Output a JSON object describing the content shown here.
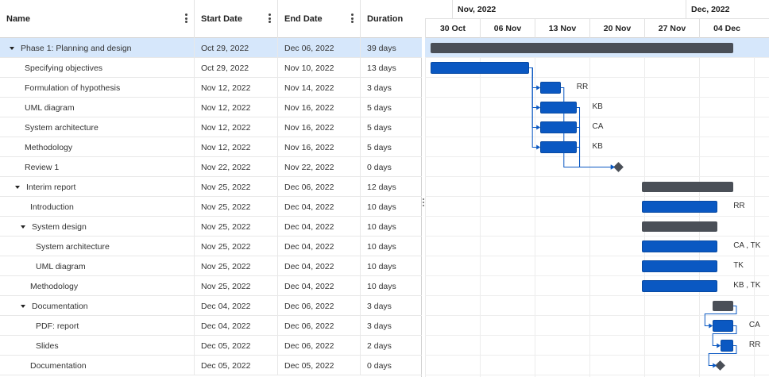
{
  "columns": {
    "name": "Name",
    "start": "Start Date",
    "end": "End Date",
    "duration": "Duration"
  },
  "timeline": {
    "months": [
      {
        "label": "Nov, 2022"
      },
      {
        "label": "Dec, 2022"
      }
    ],
    "weeks": [
      "30 Oct",
      "06 Nov",
      "13 Nov",
      "20 Nov",
      "27 Nov",
      "04 Dec"
    ]
  },
  "tasks": [
    {
      "name": "Phase 1: Planning and design",
      "start": "Oct 29, 2022",
      "end": "Dec 06, 2022",
      "duration": "39 days",
      "level": 0,
      "parent": true,
      "selected": true
    },
    {
      "name": "Specifying objectives",
      "start": "Oct 29, 2022",
      "end": "Nov 10, 2022",
      "duration": "13 days",
      "level": 1,
      "resource": ""
    },
    {
      "name": "Formulation of hypothesis",
      "start": "Nov 12, 2022",
      "end": "Nov 14, 2022",
      "duration": "3 days",
      "level": 1,
      "resource": "RR"
    },
    {
      "name": "UML diagram",
      "start": "Nov 12, 2022",
      "end": "Nov 16, 2022",
      "duration": "5 days",
      "level": 1,
      "resource": "KB"
    },
    {
      "name": "System architecture",
      "start": "Nov 12, 2022",
      "end": "Nov 16, 2022",
      "duration": "5 days",
      "level": 1,
      "resource": "CA"
    },
    {
      "name": "Methodology",
      "start": "Nov 12, 2022",
      "end": "Nov 16, 2022",
      "duration": "5 days",
      "level": 1,
      "resource": "KB"
    },
    {
      "name": "Review 1",
      "start": "Nov 22, 2022",
      "end": "Nov 22, 2022",
      "duration": "0 days",
      "level": 1,
      "milestone": true
    },
    {
      "name": "Interim report",
      "start": "Nov 25, 2022",
      "end": "Dec 06, 2022",
      "duration": "12 days",
      "level": 1,
      "parent": true
    },
    {
      "name": "Introduction",
      "start": "Nov 25, 2022",
      "end": "Dec 04, 2022",
      "duration": "10 days",
      "level": 2,
      "resource": "RR"
    },
    {
      "name": "System design",
      "start": "Nov 25, 2022",
      "end": "Dec 04, 2022",
      "duration": "10 days",
      "level": 2,
      "parent": true
    },
    {
      "name": "System architecture",
      "start": "Nov 25, 2022",
      "end": "Dec 04, 2022",
      "duration": "10 days",
      "level": 3,
      "resource": "CA , TK"
    },
    {
      "name": "UML diagram",
      "start": "Nov 25, 2022",
      "end": "Dec 04, 2022",
      "duration": "10 days",
      "level": 3,
      "resource": "TK"
    },
    {
      "name": "Methodology",
      "start": "Nov 25, 2022",
      "end": "Dec 04, 2022",
      "duration": "10 days",
      "level": 2,
      "resource": "KB , TK"
    },
    {
      "name": "Documentation",
      "start": "Dec 04, 2022",
      "end": "Dec 06, 2022",
      "duration": "3 days",
      "level": 2,
      "parent": true
    },
    {
      "name": "PDF: report",
      "start": "Dec 04, 2022",
      "end": "Dec 06, 2022",
      "duration": "3 days",
      "level": 3,
      "resource": "CA"
    },
    {
      "name": "Slides",
      "start": "Dec 05, 2022",
      "end": "Dec 06, 2022",
      "duration": "2 days",
      "level": 3,
      "resource": "RR"
    },
    {
      "name": "Documentation",
      "start": "Dec 05, 2022",
      "end": "Dec 05, 2022",
      "duration": "0 days",
      "level": 2,
      "milestone": true
    }
  ],
  "colors": {
    "task": "#0a58c2",
    "summary": "#4a4f57",
    "selected_row": "#d6e7fb",
    "link": "#0a58c2"
  }
}
